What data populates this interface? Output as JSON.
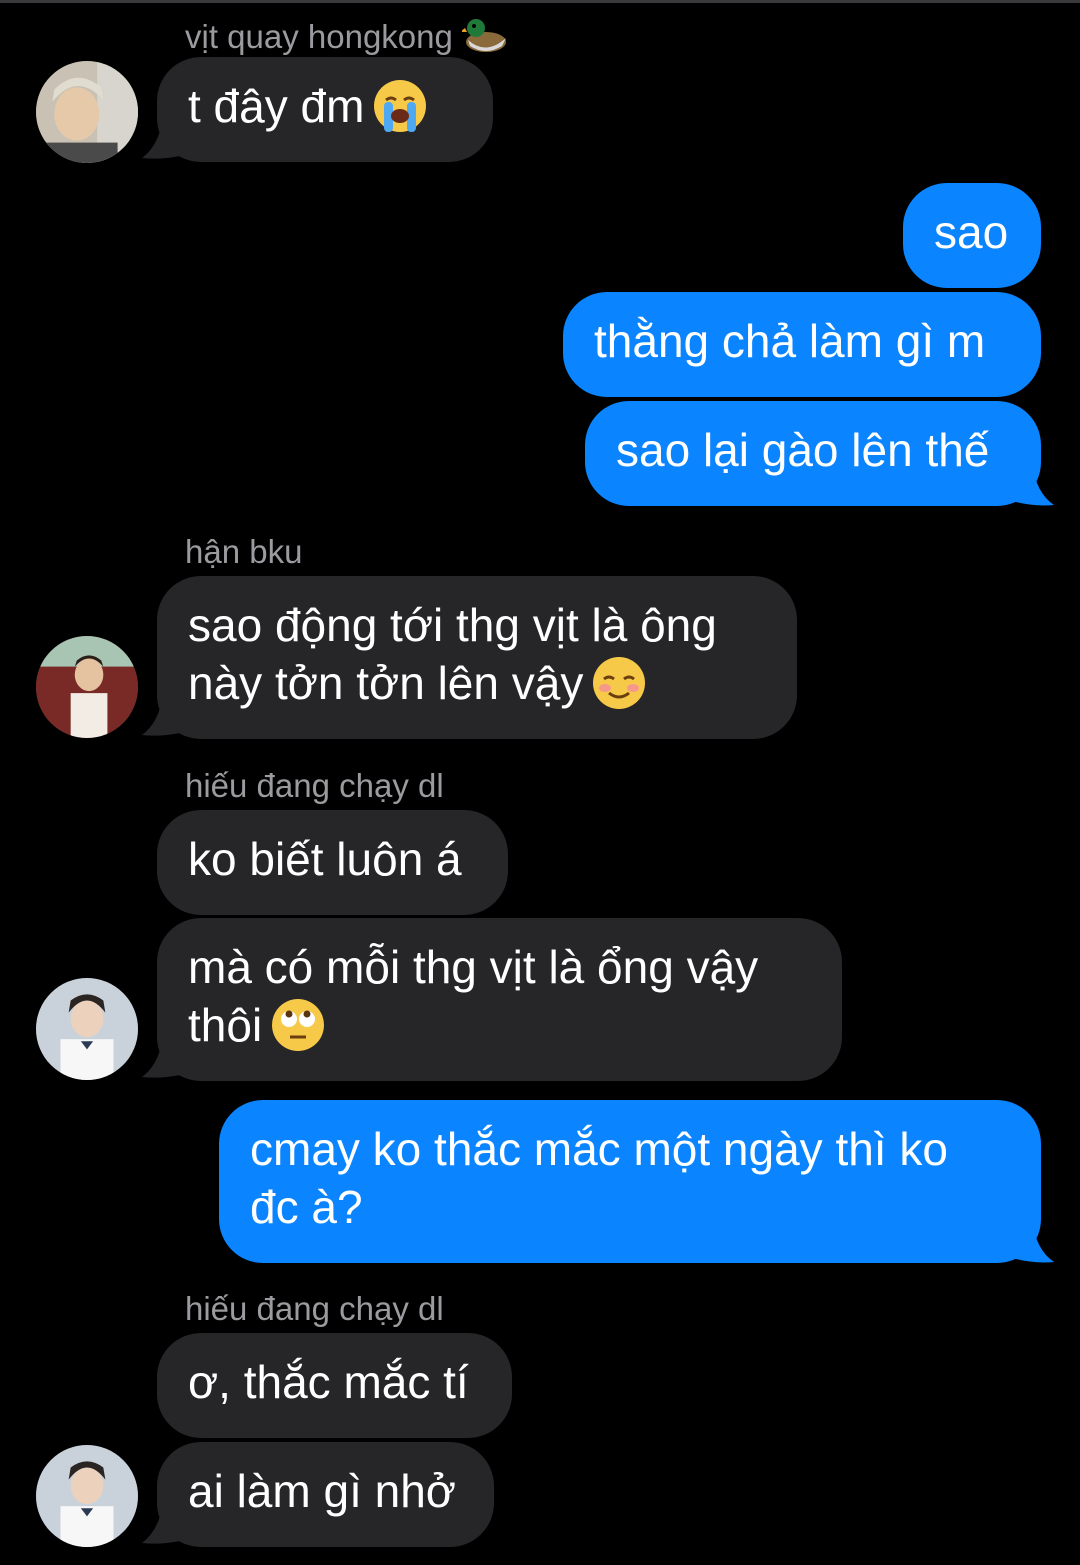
{
  "conversation": {
    "messages": [
      {
        "sender": "vịt quay hongkong",
        "text": "t đây đm",
        "emoji": "loudly-crying-face"
      },
      {
        "text": "sao"
      },
      {
        "text": "thằng chả làm gì m"
      },
      {
        "text": "sao lại gào lên thế"
      },
      {
        "sender": "hận bku",
        "line1": "sao động tới thg vịt là ông",
        "line2": "này tởn tởn lên vậy",
        "emoji": "smiling-face"
      },
      {
        "sender": "hiếu đang chạy dl",
        "text": "ko biết luôn á"
      },
      {
        "line1": "mà có mỗi thg vịt là ổng vậy",
        "line2": "thôi",
        "emoji": "face-with-rolling-eyes"
      },
      {
        "line1": "cmay ko thắc mắc một ngày thì ko",
        "line2": "đc à?"
      },
      {
        "sender": "hiếu đang chạy dl",
        "text": "ơ, thắc mắc tí"
      },
      {
        "text": "ai làm gì nhở"
      }
    ]
  },
  "colors": {
    "background": "#000000",
    "incoming_bubble": "#262629",
    "outgoing_bubble": "#0b84ff",
    "sender_name": "#9a9a9f"
  }
}
